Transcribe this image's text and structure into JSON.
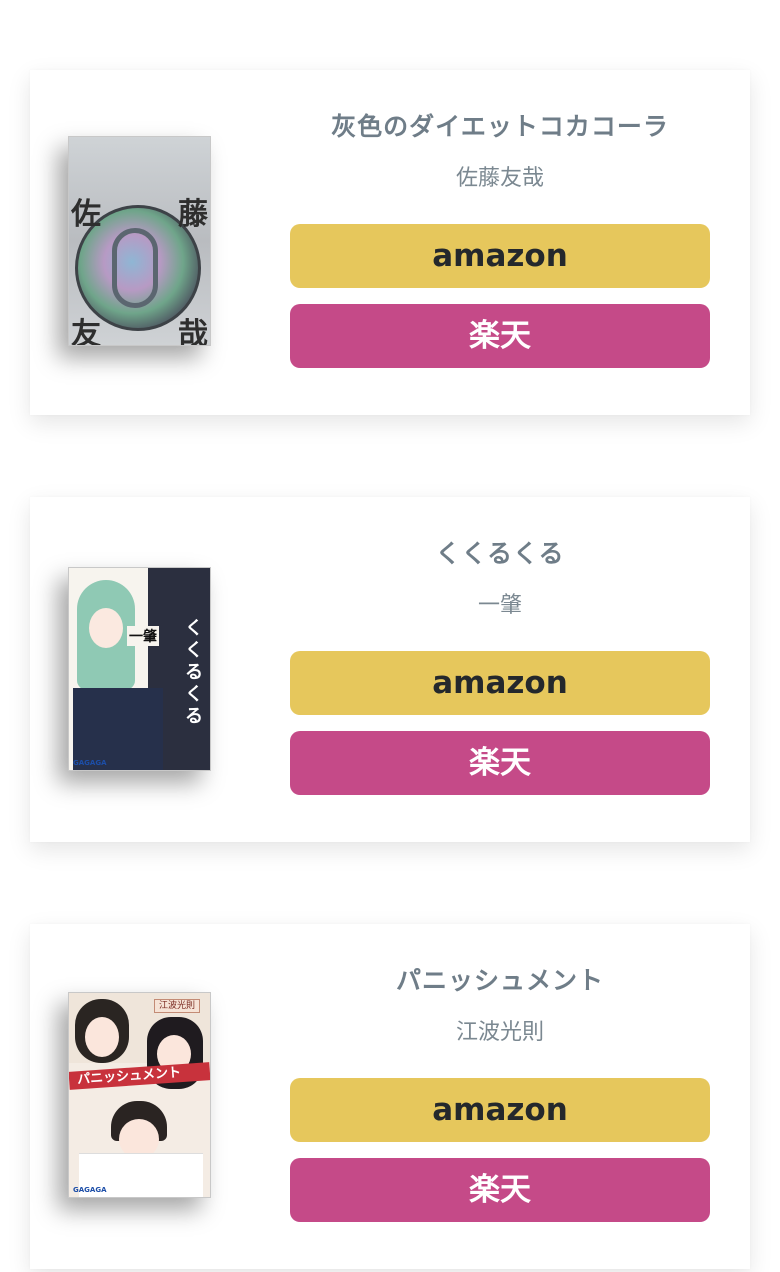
{
  "books": [
    {
      "title": "灰色のダイエットコカコーラ",
      "author": "佐藤友哉",
      "amazon_label": "amazon",
      "rakuten_label": "楽天",
      "cover_chars": [
        "佐",
        "藤",
        "友",
        "哉"
      ]
    },
    {
      "title": "くくるくる",
      "author": "一肇",
      "amazon_label": "amazon",
      "rakuten_label": "楽天",
      "cover_title": "くくるくる",
      "cover_author": "一肇",
      "cover_publisher": "GAGAGA"
    },
    {
      "title": "パニッシュメント",
      "author": "江波光則",
      "amazon_label": "amazon",
      "rakuten_label": "楽天",
      "cover_title": "パニッシュメント",
      "cover_tag": "江波光則",
      "cover_publisher": "GAGAGA"
    }
  ],
  "colors": {
    "amazon_button": "#e6c75c",
    "rakuten_button": "#c54a88",
    "title_text": "#6f7d88"
  }
}
